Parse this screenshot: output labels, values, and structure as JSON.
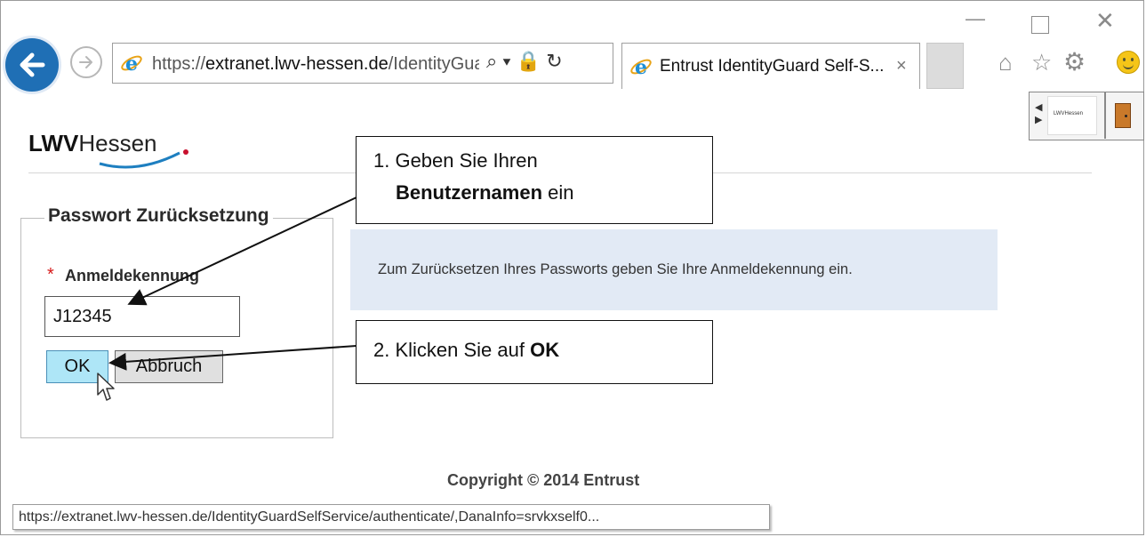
{
  "browser": {
    "address_protocol": "https://",
    "address_host_prefix": "extranet.",
    "address_host": "lwv-hessen.de",
    "address_path": "/IdentityGuar",
    "address_tools": "⌕ ▾ 🔒 ↻",
    "tab_title": "Entrust IdentityGuard Self-S...",
    "tab_close": "×",
    "window_min": "—",
    "window_close": "✕",
    "right_icons": {
      "home": "⌂",
      "star": "☆",
      "gear": "⚙"
    },
    "status_url": "https://extranet.lwv-hessen.de/IdentityGuardSelfService/authenticate/,DanaInfo=srvkxself0..."
  },
  "extension": {
    "thumb_label": "LWVHessen"
  },
  "page": {
    "logo_bold": "LWV",
    "logo_light": "Hessen",
    "form_title": "Passwort Zurücksetzung",
    "required_mark": "*",
    "field_label": "Anmeldekennung",
    "field_value": "J12345",
    "ok_label": "OK",
    "cancel_label": "Abbruch",
    "info_text": "Zum Zurücksetzen Ihres Passworts geben Sie Ihre Anmeldekennung ein.",
    "copyright": "Copyright © 2014 Entrust"
  },
  "callouts": {
    "step1_prefix": "1. Geben Sie Ihren",
    "step1_bold": "Benutzernamen",
    "step1_suffix": " ein",
    "step2_prefix": "2. Klicken Sie auf ",
    "step2_bold": "OK"
  },
  "colors": {
    "accent_blue": "#1f6fb5",
    "ok_button": "#aee6f7",
    "info_bg": "#e2eaf5",
    "required_red": "#d61a1a"
  }
}
